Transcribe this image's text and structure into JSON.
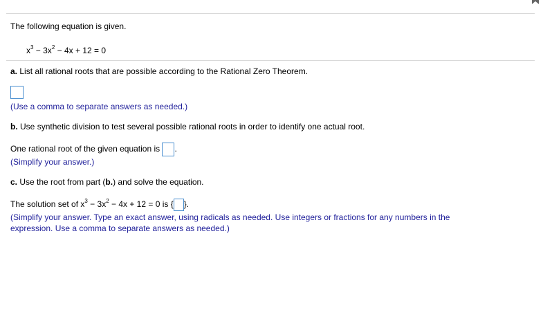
{
  "intro": "The following equation is given.",
  "equation": {
    "x_term": "x",
    "x_exp": "3",
    "rest1": " − 3x",
    "exp2": "2",
    "rest2": " − 4x + 12 = 0"
  },
  "part_a": {
    "label": "a.",
    "question": "List all rational roots that are possible according to the Rational Zero Theorem.",
    "hint": "(Use a comma to separate answers as needed.)"
  },
  "part_b": {
    "label": "b.",
    "question": "Use synthetic division to test several possible rational roots in order to identify one actual root.",
    "answer_prefix": "One rational root of the given equation is",
    "answer_suffix": ".",
    "hint": "(Simplify your answer.)"
  },
  "part_c": {
    "label": "c.",
    "question_pre": "Use the root from part (",
    "question_bold": "b.",
    "question_post": ") and solve the equation.",
    "answer_prefix": "The solution set of x",
    "answer_mid1": " − 3x",
    "answer_mid2": " − 4x + 12 = 0 is",
    "open_brace": "{",
    "close_brace": "}",
    "period": ".",
    "hint_line1": "(Simplify your answer. Type an exact answer, using radicals as needed. Use integers or fractions for any numbers in the",
    "hint_line2": "expression. Use a comma to separate answers as needed.)"
  },
  "exp3": "3",
  "exp2": "2"
}
